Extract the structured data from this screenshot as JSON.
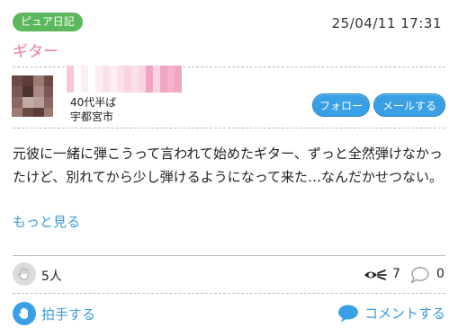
{
  "post": {
    "category_badge": "ピュア日記",
    "timestamp": "25/04/11 17:31",
    "title": "ギター",
    "body": "元彼に一緒に弾こうって言われて始めたギター、ずっと全然弾けなかったけど、別れてから少し弾けるようになって来た…なんだかせつない。",
    "more_link": "もっと見る"
  },
  "user": {
    "age": "40代半ば",
    "location": "宇都宮市",
    "follow_button": "フォロー",
    "mail_button": "メールする"
  },
  "stats": {
    "claps": "5人",
    "views": "7",
    "comments": "0"
  },
  "actions": {
    "clap_label": "拍手する",
    "comment_label": "コメントする"
  },
  "colors": {
    "badge_green": "#5cb85c",
    "title_pink": "#e879a8",
    "link_blue": "#3a9ad9",
    "button_blue": "#3aa0e6"
  },
  "icons": [
    "clap-hand-icon",
    "eye-icon",
    "speech-bubble-icon",
    "clap-action-icon",
    "comment-action-icon"
  ]
}
